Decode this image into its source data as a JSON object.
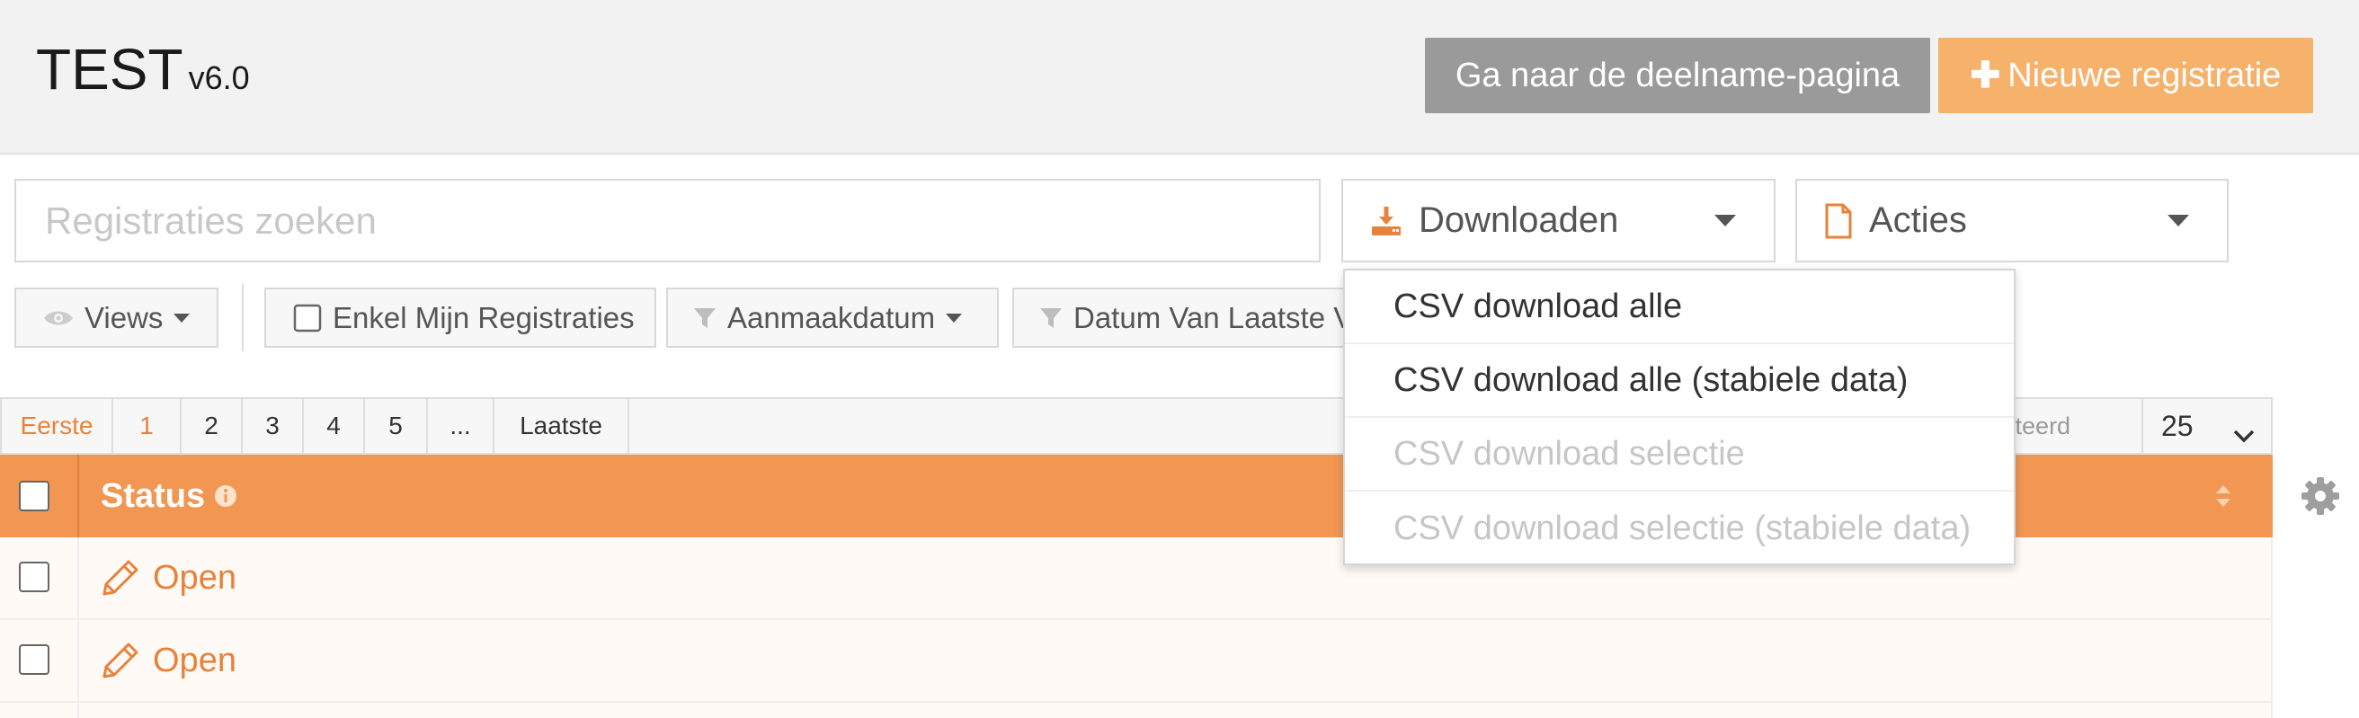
{
  "app": {
    "title": "TEST",
    "version": "v6.0"
  },
  "header": {
    "participation_button": "Ga naar de deelname-pagina",
    "new_registration_button": "Nieuwe registratie",
    "new_registration_icon": "plus-icon"
  },
  "search": {
    "placeholder": "Registraties zoeken",
    "value": ""
  },
  "toolbar": {
    "download_label": "Downloaden",
    "download_icon": "download-icon",
    "actions_label": "Acties",
    "actions_icon": "file-icon"
  },
  "filters": {
    "views_label": "Views",
    "my_registrations_label": "Enkel Mijn Registraties",
    "creation_date_label": "Aanmaakdatum",
    "last_date_label": "Datum Van Laatste V"
  },
  "pagination": {
    "first_label": "Eerste",
    "pages": [
      "1",
      "2",
      "3",
      "4",
      "5",
      "..."
    ],
    "current_page": "1",
    "last_label": "Laatste",
    "selected_text": "electeerd",
    "page_size": "25"
  },
  "table": {
    "columns": [
      {
        "label": "Status",
        "info_icon": "info-icon",
        "sort_icon": "sort-icon"
      }
    ],
    "rows": [
      {
        "status": "Open",
        "icon": "pencil-icon"
      },
      {
        "status": "Open",
        "icon": "pencil-icon"
      }
    ]
  },
  "download_menu": {
    "items": [
      {
        "label": "CSV download alle",
        "enabled": true
      },
      {
        "label": "CSV download alle (stabiele data)",
        "enabled": true
      },
      {
        "label": "CSV download selectie",
        "enabled": false
      },
      {
        "label": "CSV download selectie (stabiele data)",
        "enabled": false
      }
    ]
  },
  "colors": {
    "accent": "#f19752",
    "accent_light": "#f6b26b",
    "link": "#e8823a",
    "grey_button": "#9a9a9a",
    "header_bg": "#f2f2f2"
  }
}
